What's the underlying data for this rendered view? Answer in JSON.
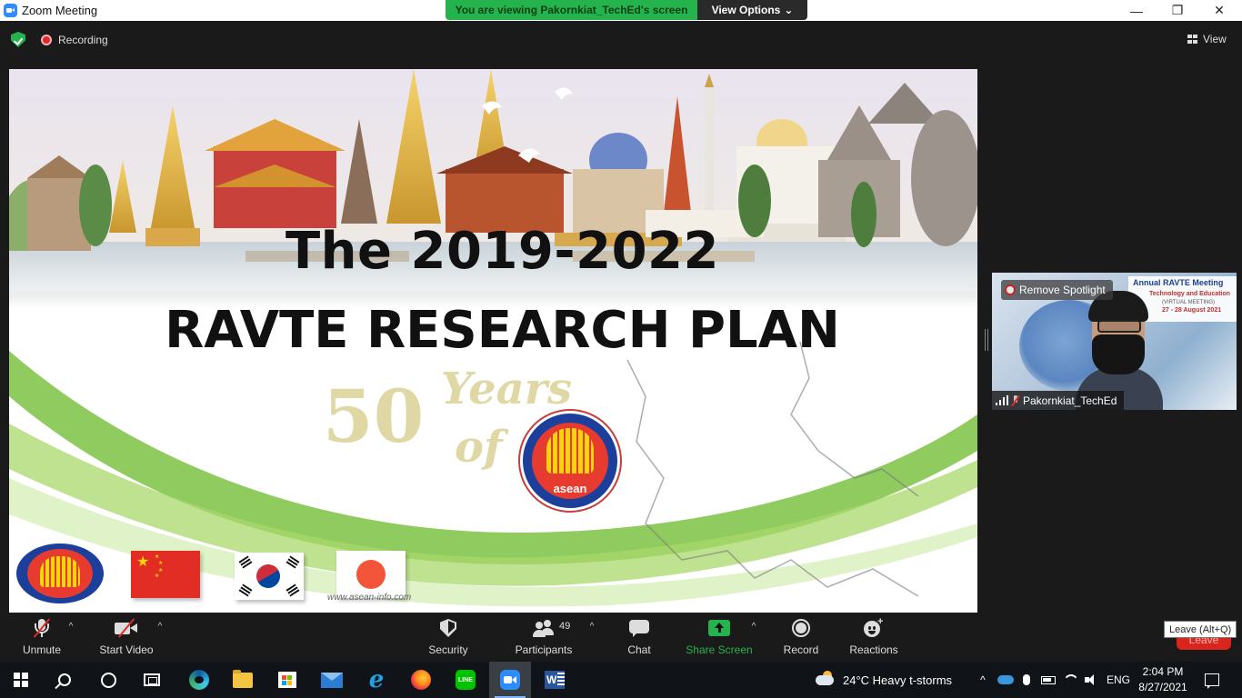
{
  "window": {
    "title": "Zoom Meeting",
    "minimize": "—",
    "maximize": "❐",
    "close": "✕"
  },
  "banner": {
    "viewing_text": "You are viewing Pakornkiat_TechEd's screen",
    "view_options_label": "View Options",
    "view_options_caret": "⌄"
  },
  "top_bar": {
    "recording_label": "Recording",
    "view_label": "View"
  },
  "slide": {
    "heading_line1": "The 2019-2022",
    "heading_line2": "RAVTE RESEARCH PLAN",
    "years_text": "50 Years of",
    "emblem_word": "asean",
    "watermark_url": "www.asean-info.com"
  },
  "video_tile": {
    "spotlight_label": "Remove Spotlight",
    "participant_name": "Pakornkiat_TechEd",
    "backdrop_line1": "Annual RAVTE Meeting",
    "backdrop_line2": "Technology and Education",
    "backdrop_line3": "(VIRTUAL MEETING)",
    "backdrop_line4": "27 - 28 August 2021"
  },
  "controls": {
    "unmute_label": "Unmute",
    "start_video_label": "Start Video",
    "security_label": "Security",
    "participants_label": "Participants",
    "participants_count": "49",
    "chat_label": "Chat",
    "share_screen_label": "Share Screen",
    "record_label": "Record",
    "reactions_label": "Reactions",
    "caret": "^",
    "leave_label": "Leave",
    "leave_tooltip": "Leave (Alt+Q)"
  },
  "taskbar": {
    "weather": "24°C  Heavy t-storms",
    "tray_chevron": "^",
    "language": "ENG",
    "time": "2:04 PM",
    "date": "8/27/2021",
    "ie_glyph": "e",
    "line_glyph": "LINE",
    "word_glyph": "W"
  },
  "colors": {
    "zoom_blue": "#2d8cff",
    "viewing_green": "#24b34c",
    "leave_red": "#d9251d",
    "toolbar_bg": "#1a1a1a"
  }
}
